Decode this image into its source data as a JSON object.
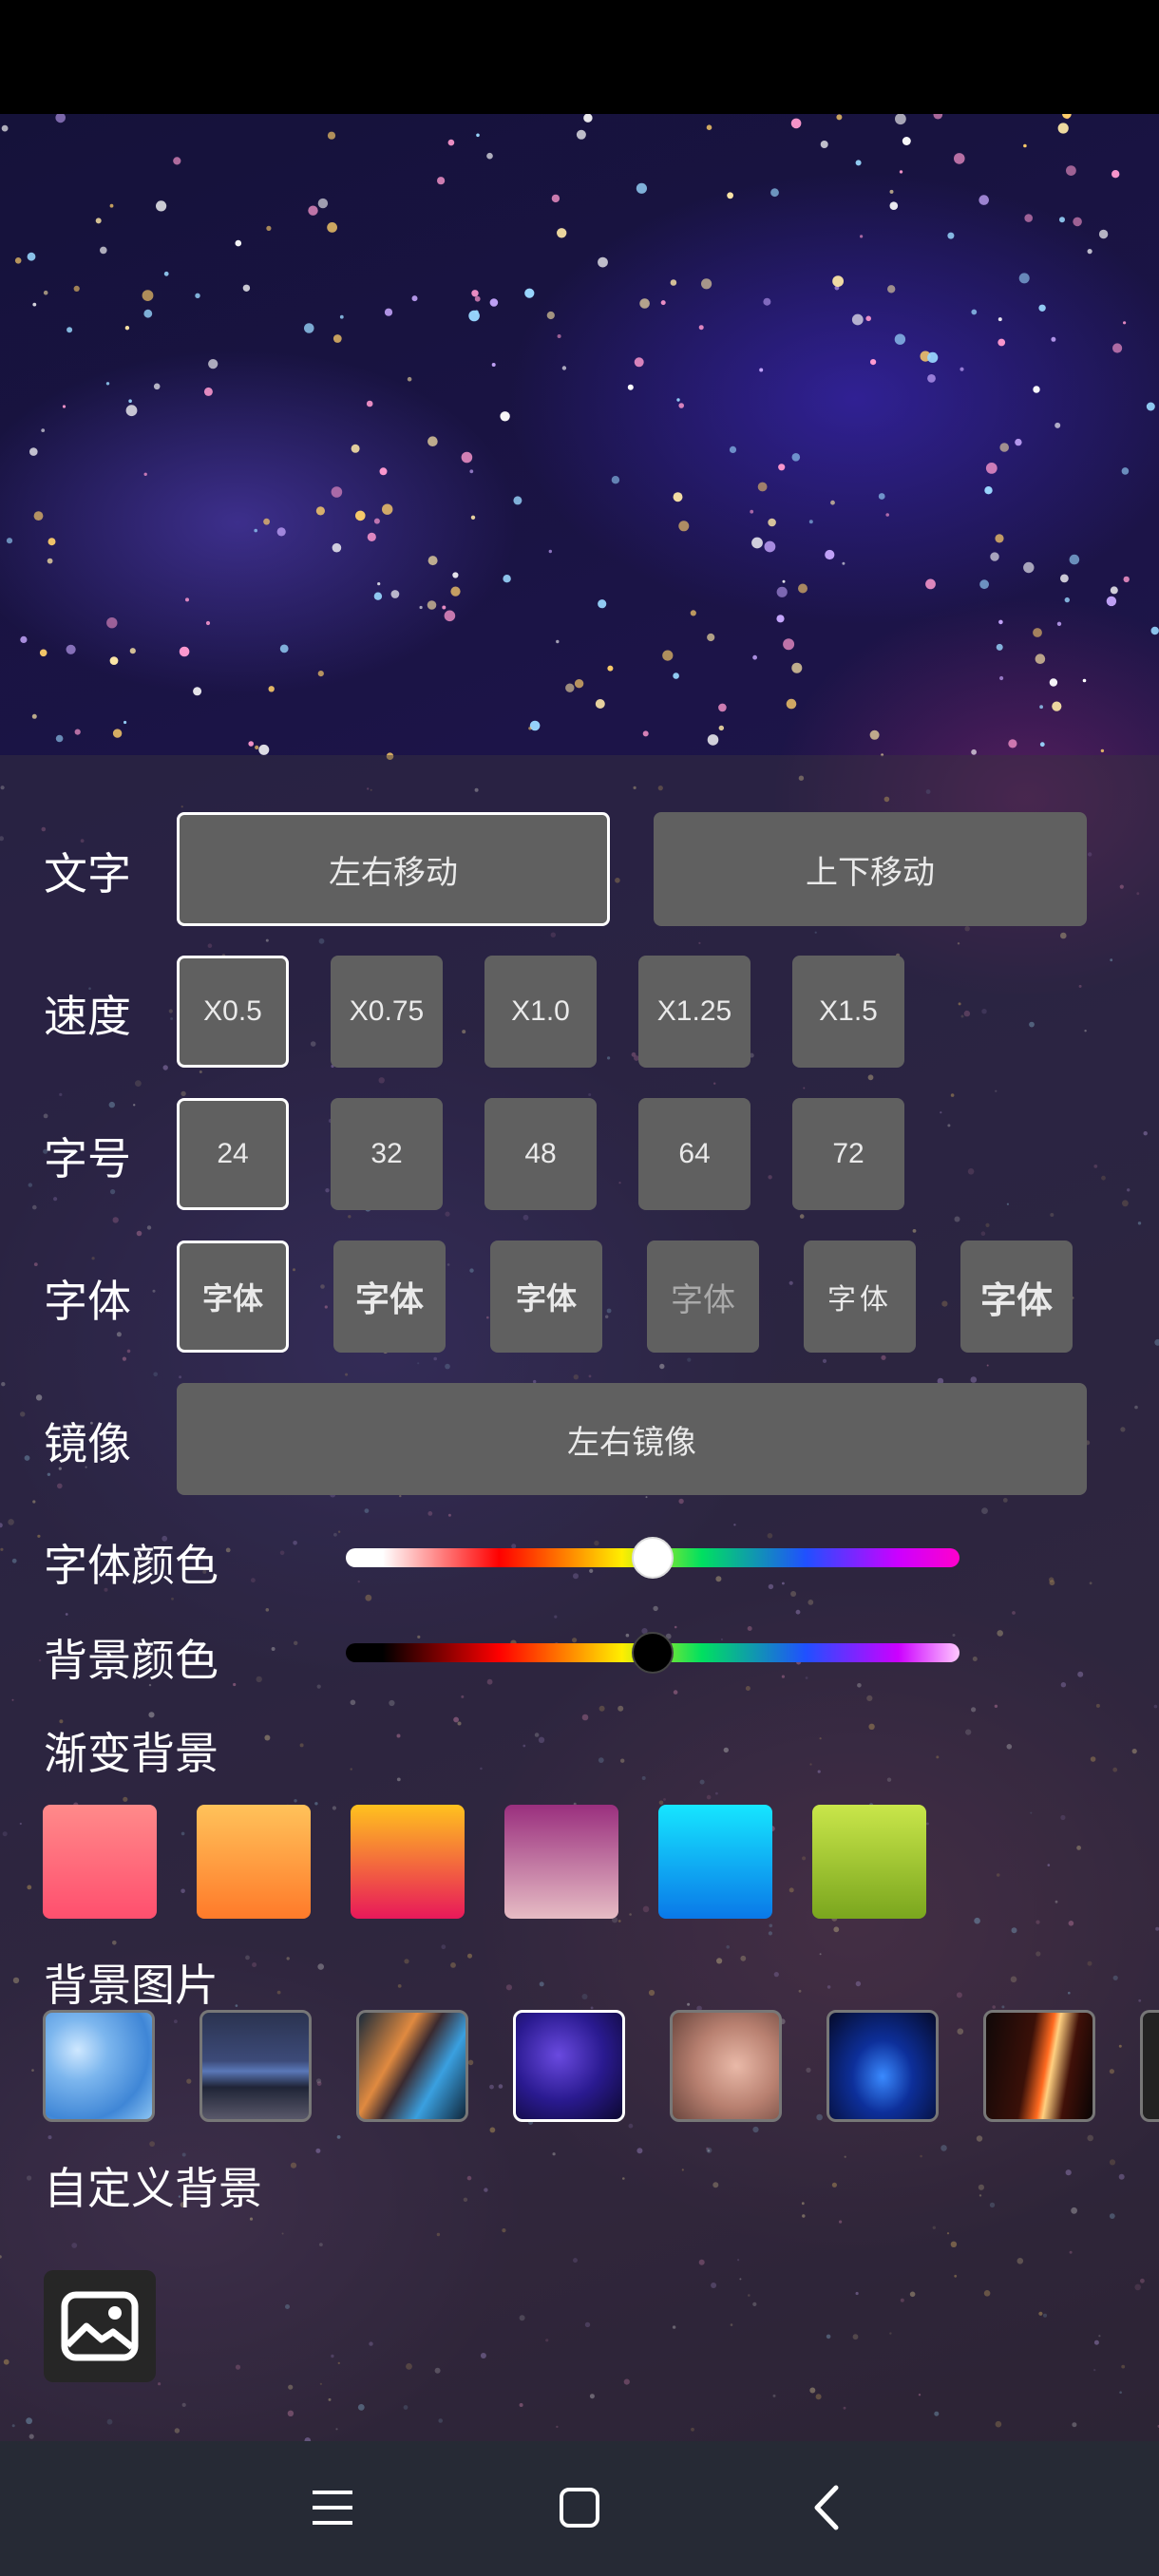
{
  "text_section": {
    "label": "文字",
    "options": [
      "左右移动",
      "上下移动"
    ],
    "selected": 0
  },
  "speed_section": {
    "label": "速度",
    "options": [
      "X0.5",
      "X0.75",
      "X1.0",
      "X1.25",
      "X1.5"
    ],
    "selected": 0
  },
  "size_section": {
    "label": "字号",
    "options": [
      "24",
      "32",
      "48",
      "64",
      "72"
    ],
    "selected": 0
  },
  "font_section": {
    "label": "字体",
    "options": [
      "字体",
      "字体",
      "字体",
      "字体",
      "字体",
      "字体"
    ],
    "selected": 0
  },
  "mirror_section": {
    "label": "镜像",
    "button": "左右镜像"
  },
  "font_color": {
    "label": "字体颜色",
    "value": 0.5
  },
  "bg_color": {
    "label": "背景颜色",
    "value": 0.5
  },
  "gradient_bg": {
    "label": "渐变背景",
    "swatches": [
      [
        "#ff8a8a",
        "#ff4f6e"
      ],
      [
        "#ffc25a",
        "#ff7a2a"
      ],
      [
        "#ffc21e",
        "#e8185a"
      ],
      [
        "#9a2f7e",
        "#e6bcc4"
      ],
      [
        "#16e6ff",
        "#0a78e8"
      ],
      [
        "#c9e64a",
        "#7aa61e"
      ]
    ]
  },
  "bg_images": {
    "label": "背景图片",
    "selected": 3,
    "count": 8
  },
  "custom_bg": {
    "label": "自定义背景",
    "icon": "image-icon"
  },
  "nav": {
    "menu_icon": "menu-icon",
    "home_icon": "home-icon",
    "back_icon": "back-icon"
  }
}
